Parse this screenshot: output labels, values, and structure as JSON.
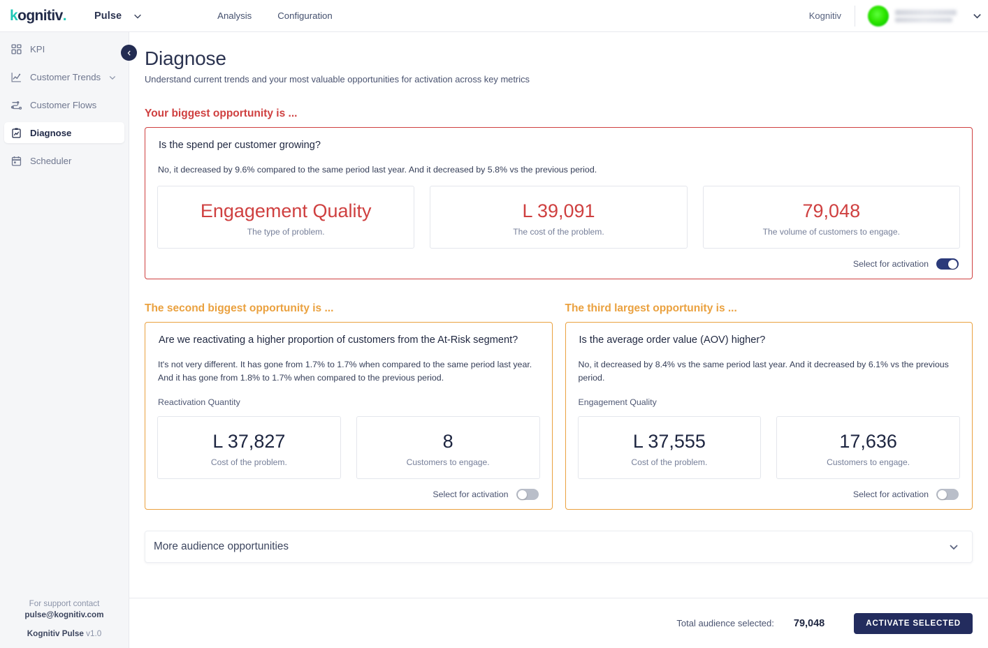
{
  "topbar": {
    "logo_k": "k",
    "logo_rest": "ognitiv",
    "logo_dot": ".",
    "product": "Pulse",
    "nav": [
      {
        "label": "Analysis"
      },
      {
        "label": "Configuration"
      }
    ],
    "tenant": "Kognitiv",
    "user_name": "",
    "user_role": ""
  },
  "sidebar": {
    "items": [
      {
        "label": "KPI",
        "icon": "grid-icon",
        "active": false,
        "expandable": false
      },
      {
        "label": "Customer Trends",
        "icon": "line-chart-icon",
        "active": false,
        "expandable": true
      },
      {
        "label": "Customer Flows",
        "icon": "flow-icon",
        "active": false,
        "expandable": false
      },
      {
        "label": "Diagnose",
        "icon": "clipboard-chart-icon",
        "active": true,
        "expandable": false
      },
      {
        "label": "Scheduler",
        "icon": "calendar-icon",
        "active": false,
        "expandable": false
      }
    ],
    "footer": {
      "support_line": "For support contact",
      "support_email": "pulse@kognitiv.com",
      "product_name": "Kognitiv Pulse",
      "version": "v1.0"
    }
  },
  "page": {
    "title": "Diagnose",
    "subtitle": "Understand current trends and your most valuable opportunities for activation across key metrics"
  },
  "opportunities": {
    "first": {
      "section_title": "Your biggest opportunity is ...",
      "accent": "#cf4040",
      "question": "Is the spend per customer growing?",
      "description": "No, it decreased by 9.6% compared to the same period last year. And it decreased by 5.8% vs the previous period.",
      "metrics": [
        {
          "value": "Engagement Quality",
          "caption": "The type of problem.",
          "style": "red"
        },
        {
          "value": "L 39,091",
          "caption": "The cost of the problem.",
          "style": "red"
        },
        {
          "value": "79,048",
          "caption": "The volume of customers to engage.",
          "style": "red"
        }
      ],
      "toggle_label": "Select for activation",
      "toggle_on": true
    },
    "second": {
      "section_title": "The second biggest opportunity is ...",
      "accent": "#eaa13f",
      "question": "Are we reactivating a higher proportion of customers from the At-Risk segment?",
      "description": "It's not very different. It has gone from 1.7% to 1.7% when compared to the same period last year. And it has gone from 1.8% to 1.7% when compared to the previous period.",
      "tag": "Reactivation Quantity",
      "metrics": [
        {
          "value": "L 37,827",
          "caption": "Cost of the problem.",
          "style": "dark"
        },
        {
          "value": "8",
          "caption": "Customers to engage.",
          "style": "dark"
        }
      ],
      "toggle_label": "Select for activation",
      "toggle_on": false
    },
    "third": {
      "section_title": "The third largest opportunity is ...",
      "accent": "#eaa13f",
      "question": "Is the average order value (AOV) higher?",
      "description": "No, it decreased by 8.4% vs the same period last year. And it decreased by 6.1% vs the previous period.",
      "tag": "Engagement Quality",
      "metrics": [
        {
          "value": "L 37,555",
          "caption": "Cost of the problem.",
          "style": "dark"
        },
        {
          "value": "17,636",
          "caption": "Customers to engage.",
          "style": "dark"
        }
      ],
      "toggle_label": "Select for activation",
      "toggle_on": false
    }
  },
  "more_section": {
    "label": "More audience opportunities",
    "expanded": false
  },
  "footer": {
    "total_label": "Total audience selected:",
    "total_value": "79,048",
    "activate_label": "ACTIVATE SELECTED"
  },
  "colors": {
    "brand_teal": "#1fc7b6",
    "brand_navy": "#232c5e",
    "danger_red": "#cf4040",
    "warn_amber": "#eaa13f",
    "sidebar_bg": "#f5f6f8"
  }
}
